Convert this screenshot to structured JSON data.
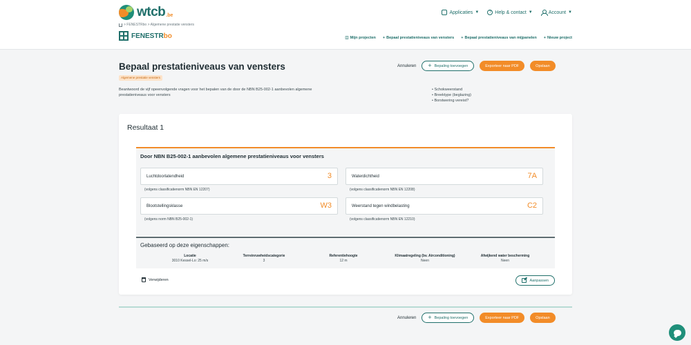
{
  "brand": {
    "logo_text": "wtcb",
    "logo_suffix": ".be"
  },
  "topnav": [
    {
      "label": "Applicaties",
      "icon": "grid-icon"
    },
    {
      "label": "Help & contact",
      "icon": "help-icon"
    },
    {
      "label": "Account",
      "icon": "user-icon"
    }
  ],
  "breadcrumb": "> FENESTRbo > Algemene prestatie vensters",
  "app": {
    "name": "FENESTR",
    "name_suffix": "bo"
  },
  "appnav": [
    {
      "label": "Mijn projecten",
      "icon": "layers-icon"
    },
    {
      "label": "Bepaal prestatieniveaus van vensters",
      "icon": "plus-icon"
    },
    {
      "label": "Bepaal prestatieniveaus van mijpanelen",
      "icon": "plus-icon"
    },
    {
      "label": "Nieuw project",
      "icon": "plus-icon"
    }
  ],
  "page": {
    "title": "Bepaal prestatieniveaus van vensters",
    "tag": "Algemene prestatie vensters",
    "intro": "Beantwoord de vijf opeenvolgende vragen voor het bepalen van de door de NBN B25-002-1 aanbevolen algemene prestatieniveaus voor vensters",
    "checks": [
      "Schokweerstand",
      "Breektype (beglazing)",
      "Borstwering vereist?"
    ]
  },
  "actions": {
    "cancel": "Annuleren",
    "add": "Bepaling toevoegen",
    "export": "Exporteer naar PDF",
    "save": "Opslaan"
  },
  "result": {
    "title": "Resultaat 1",
    "section_title": "Door NBN B25-002-1 aanbevolen algemene prestatieniveaus voor vensters",
    "items": [
      {
        "label": "Luchtdoorlatendheid",
        "value": "3",
        "note": "(volgens classificatienorm NBN EN 12207)"
      },
      {
        "label": "Waterdichtheid",
        "value": "7A",
        "note": "(volgens classificatienorm NBN EN 12208)"
      },
      {
        "label": "Blootstellingsklasse",
        "value": "W3",
        "note": "(volgens norm NBN B25-002-1)"
      },
      {
        "label": "Weerstand tegen windbelasting",
        "value": "C2",
        "note": "(volgens classificatienorm NBN EN 12210)"
      }
    ],
    "props_title": "Gebaseerd op deze eigenschappen:",
    "props": [
      {
        "label": "Locatie",
        "value": "3010 Kessel-Lo: 25 m/s"
      },
      {
        "label": "Terreinruwheidscategorie",
        "value": "3"
      },
      {
        "label": "Referentiehoogte",
        "value": "12 m"
      },
      {
        "label": "Klimaatregeling (bv. Airconditioning)",
        "value": "Neen"
      },
      {
        "label": "Afwijkend water bescherming",
        "value": "Neen"
      }
    ],
    "delete": "Verwijderen",
    "edit": "Aanpassen"
  }
}
